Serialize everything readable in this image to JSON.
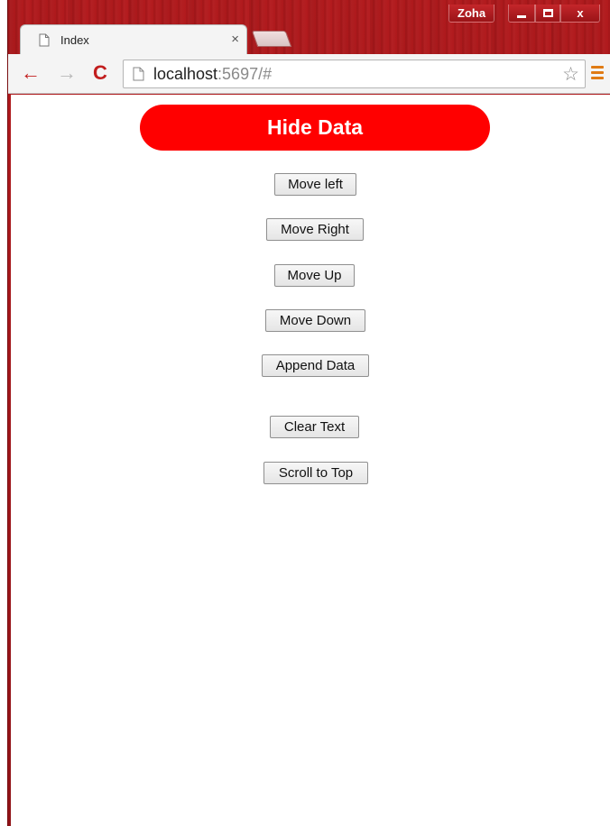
{
  "window": {
    "profile_name": "Zoha",
    "close_glyph": "x"
  },
  "tab": {
    "title": "Index",
    "close_glyph": "×"
  },
  "toolbar": {
    "back_glyph": "←",
    "forward_glyph": "→",
    "reload_glyph": "C",
    "url_host": "localhost",
    "url_rest": ":5697/#",
    "star_glyph": "☆"
  },
  "page": {
    "hide_data_label": "Hide Data",
    "buttons": [
      "Move left",
      "Move Right",
      "Move Up",
      "Move Down",
      "Append Data",
      "Clear Text",
      "Scroll to Top"
    ]
  },
  "colors": {
    "accent_red": "#ff0000",
    "frame_red": "#a3161a",
    "menu_orange": "#e07b14"
  }
}
